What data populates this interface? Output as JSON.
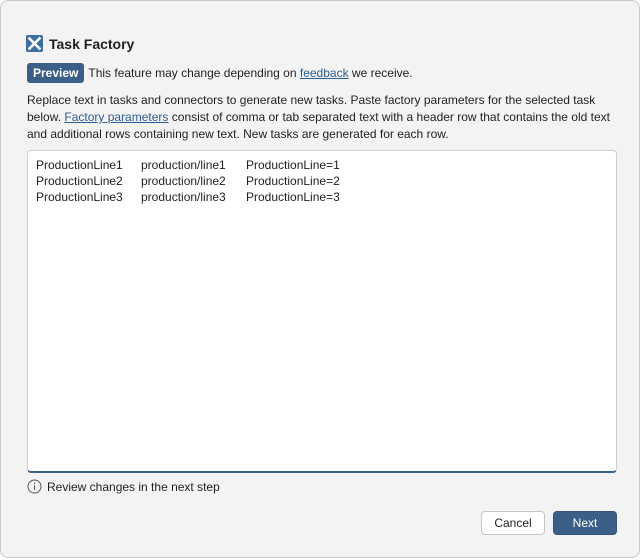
{
  "dialog": {
    "title": "Task Factory",
    "icon": "task-factory-icon",
    "accent_color": "#3c5f87"
  },
  "preview": {
    "badge": "Preview",
    "text_before": "This feature may change depending on",
    "link_text": "feedback",
    "text_after": "we receive."
  },
  "description": {
    "part1": "Replace text in tasks and connectors to generate new tasks. Paste factory parameters for the selected task below.",
    "link_text": "Factory parameters",
    "part2": "consist of comma or tab separated text with a header row that contains the old text and additional rows containing new text. New tasks are generated for each row."
  },
  "editor": {
    "rows": [
      [
        "ProductionLine1",
        "production/line1",
        "ProductionLine=1"
      ],
      [
        "ProductionLine2",
        "production/line2",
        "ProductionLine=2"
      ],
      [
        "ProductionLine3",
        "production/line3",
        "ProductionLine=3"
      ]
    ]
  },
  "hint": {
    "icon": "info-icon",
    "text": "Review changes in the next step"
  },
  "buttons": {
    "cancel": "Cancel",
    "next": "Next"
  }
}
